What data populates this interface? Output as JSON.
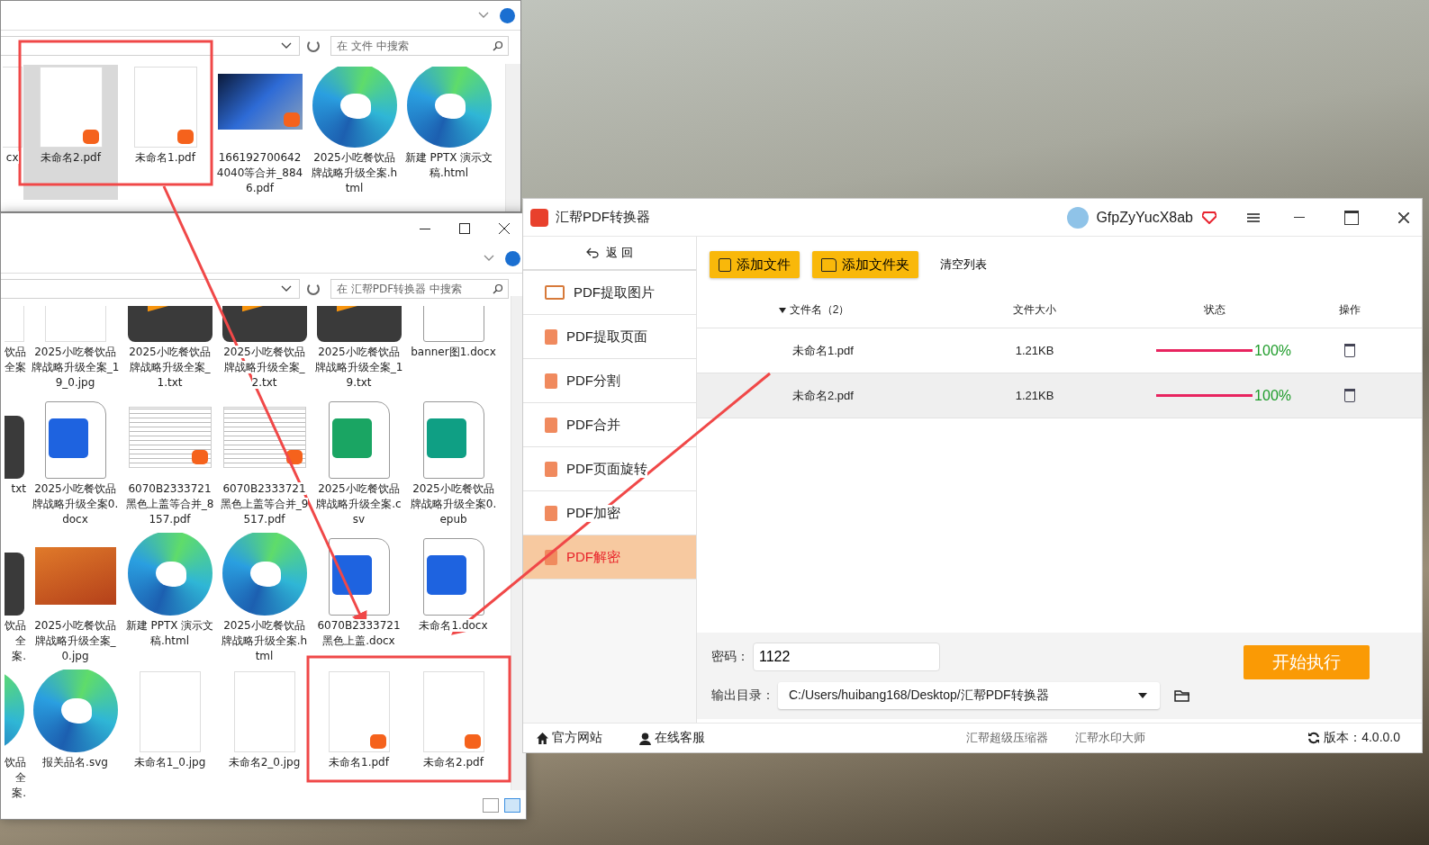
{
  "explorer_back": {
    "search_placeholder": "在 文件 中搜索",
    "files": [
      {
        "name": "cx",
        "kind": "blank",
        "selected": false
      },
      {
        "name": "未命名2.pdf",
        "kind": "blank-pdf",
        "selected": true
      },
      {
        "name": "未命名1.pdf",
        "kind": "blank-pdf",
        "selected": false
      },
      {
        "name": "1661927006424040等合并_8846.pdf",
        "kind": "photo-pdf",
        "selected": false
      },
      {
        "name": "2025小吃餐饮品牌战略升级全案.html",
        "kind": "browser",
        "selected": false
      },
      {
        "name": "新建 PPTX 演示文稿.html",
        "kind": "browser",
        "selected": false
      }
    ]
  },
  "explorer_front": {
    "search_placeholder": "在 汇帮PDF转换器 中搜索",
    "files": [
      {
        "name": "饮品全案",
        "kind": "blank"
      },
      {
        "name": "2025小吃餐饮品牌战略升级全案_19_0.jpg",
        "kind": "blank"
      },
      {
        "name": "2025小吃餐饮品牌战略升级全案_1.txt",
        "kind": "txt"
      },
      {
        "name": "2025小吃餐饮品牌战略升级全案_2.txt",
        "kind": "txt"
      },
      {
        "name": "2025小吃餐饮品牌战略升级全案_19.txt",
        "kind": "txt"
      },
      {
        "name": "banner图1.docx",
        "kind": "doc"
      },
      {
        "name": "txt",
        "kind": "txt"
      },
      {
        "name": "2025小吃餐饮品牌战略升级全案0.docx",
        "kind": "word"
      },
      {
        "name": "6070B2333721黑色上盖等合并_8157.pdf",
        "kind": "scan-pdf"
      },
      {
        "name": "6070B2333721黑色上盖等合并_9517.pdf",
        "kind": "scan-pdf"
      },
      {
        "name": "2025小吃餐饮品牌战略升级全案.csv",
        "kind": "sheet"
      },
      {
        "name": "2025小吃餐饮品牌战略升级全案0.epub",
        "kind": "book"
      },
      {
        "name": "饮品全案.",
        "kind": "txt"
      },
      {
        "name": "2025小吃餐饮品牌战略升级全案_0.jpg",
        "kind": "photo"
      },
      {
        "name": "新建 PPTX 演示文稿.html",
        "kind": "browser"
      },
      {
        "name": "2025小吃餐饮品牌战略升级全案.html",
        "kind": "browser"
      },
      {
        "name": "6070B2333721黑色上盖.docx",
        "kind": "word"
      },
      {
        "name": "未命名1.docx",
        "kind": "word"
      },
      {
        "name": "饮品全案.",
        "kind": "browser"
      },
      {
        "name": "报关品名.svg",
        "kind": "browser"
      },
      {
        "name": "未命名1_0.jpg",
        "kind": "blank"
      },
      {
        "name": "未命名2_0.jpg",
        "kind": "blank"
      },
      {
        "name": "未命名1.pdf",
        "kind": "blank-pdf"
      },
      {
        "name": "未命名2.pdf",
        "kind": "blank-pdf"
      }
    ]
  },
  "app": {
    "title": "汇帮PDF转换器",
    "user": "GfpZyYucX8ab",
    "sidebar": {
      "back": "返 回",
      "items": [
        {
          "label": "PDF提取图片",
          "kind": "image",
          "selected": false
        },
        {
          "label": "PDF提取页面",
          "kind": "pdf",
          "selected": false
        },
        {
          "label": "PDF分割",
          "kind": "pdf",
          "selected": false
        },
        {
          "label": "PDF合并",
          "kind": "pdf",
          "selected": false
        },
        {
          "label": "PDF页面旋转",
          "kind": "pdf",
          "selected": false
        },
        {
          "label": "PDF加密",
          "kind": "pdf",
          "selected": false
        },
        {
          "label": "PDF解密",
          "kind": "pdf",
          "selected": true
        }
      ]
    },
    "toolbar": [
      {
        "label": "添加文件",
        "kind": "file"
      },
      {
        "label": "添加文件夹",
        "kind": "folder"
      },
      {
        "label": "清空列表",
        "kind": "text"
      }
    ],
    "table": {
      "columns": [
        "文件名（2）",
        "文件大小",
        "状态",
        "操作"
      ],
      "rows": [
        {
          "name": "未命名1.pdf",
          "size": "1.21KB",
          "level": 1,
          "reading": "100%",
          "selected": false
        },
        {
          "name": "未命名2.pdf",
          "size": "1.21KB",
          "level": 1,
          "reading": "100%",
          "selected": true
        }
      ]
    },
    "password": {
      "label": "密码：",
      "value": "1122"
    },
    "output": {
      "label": "输出目录：",
      "value": "C:/Users/huibang168/Desktop/汇帮PDF转换器"
    },
    "start_button": "开始执行",
    "footer": {
      "links": [
        {
          "label": "官方网站",
          "kind": "home"
        },
        {
          "label": "在线客服",
          "kind": "support"
        },
        {
          "label": "汇帮超级压缩器",
          "kind": "plain"
        },
        {
          "label": "汇帮水印大师",
          "kind": "plain"
        }
      ],
      "version": "版本：4.0.0.0"
    }
  }
}
